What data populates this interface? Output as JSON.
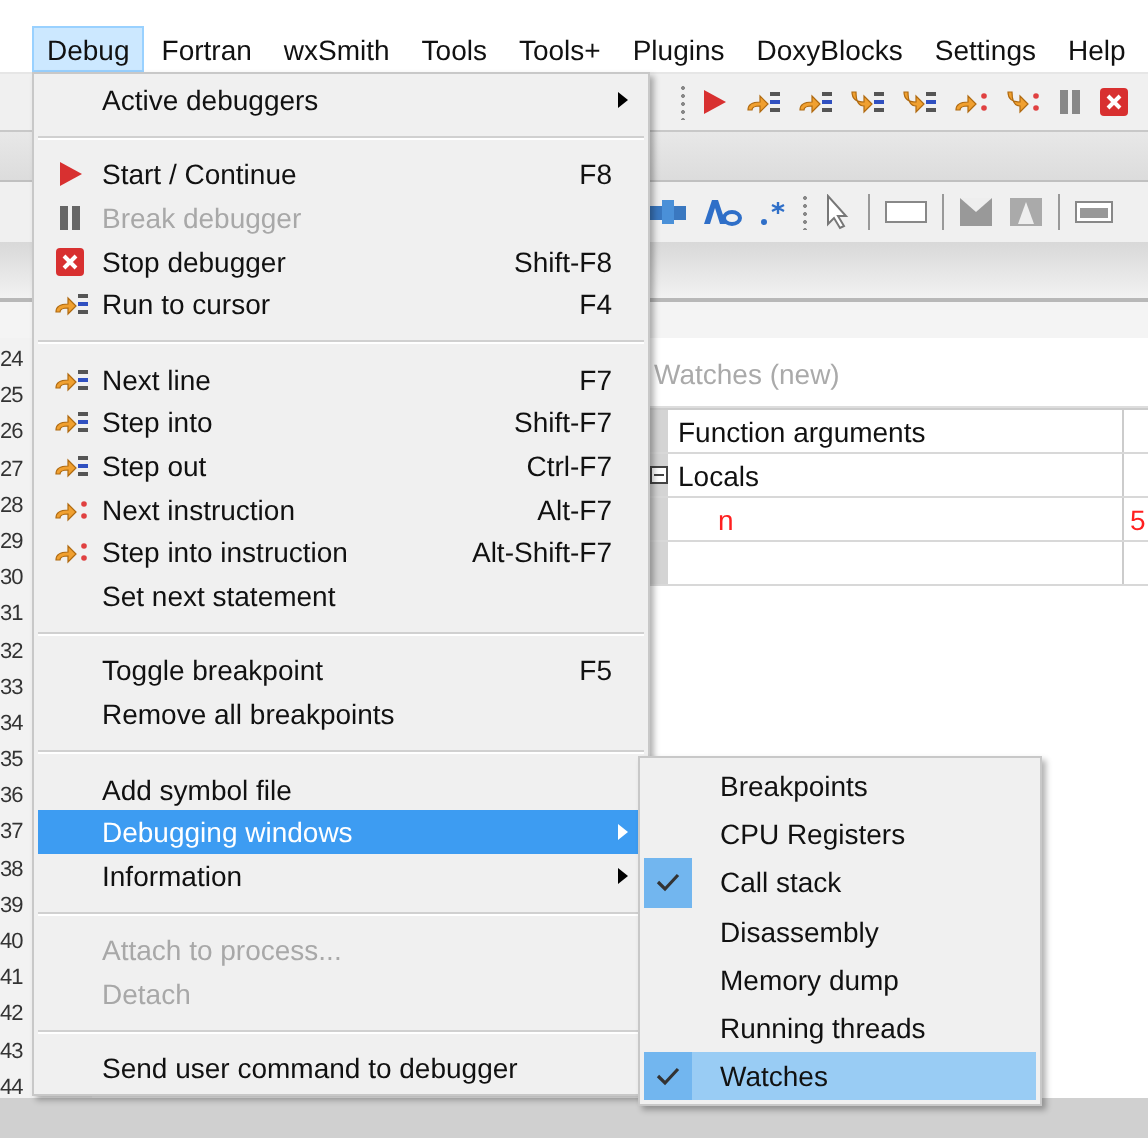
{
  "menubar": [
    {
      "label": "Debug",
      "selected": true
    },
    {
      "label": "Fortran",
      "selected": false
    },
    {
      "label": "wxSmith",
      "selected": false
    },
    {
      "label": "Tools",
      "selected": false
    },
    {
      "label": "Tools+",
      "selected": false
    },
    {
      "label": "Plugins",
      "selected": false
    },
    {
      "label": "DoxyBlocks",
      "selected": false
    },
    {
      "label": "Settings",
      "selected": false
    },
    {
      "label": "Help",
      "selected": false
    }
  ],
  "line_numbers": [
    "24",
    "25",
    "26",
    "27",
    "28",
    "29",
    "30",
    "31",
    "32",
    "33",
    "34",
    "35",
    "36",
    "37",
    "38",
    "39",
    "40",
    "41",
    "42",
    "43",
    "44"
  ],
  "watches": {
    "title": "Watches (new)",
    "rows": [
      {
        "kind": "group",
        "name": "Function arguments"
      },
      {
        "kind": "group",
        "name": "Locals",
        "expanded": true
      },
      {
        "kind": "variable",
        "name": "n",
        "value": "5",
        "changed": true
      }
    ]
  },
  "debug_menu": {
    "items": [
      {
        "kind": "item",
        "label": "Active debuggers",
        "submenu": true,
        "disabled": false,
        "selected": false
      },
      {
        "kind": "separator"
      },
      {
        "kind": "item",
        "label": "Start / Continue",
        "shortcut": "F8",
        "disabled": false,
        "selected": false
      },
      {
        "kind": "item",
        "label": "Break debugger",
        "disabled": true,
        "selected": false
      },
      {
        "kind": "item",
        "label": "Stop debugger",
        "shortcut": "Shift-F8",
        "disabled": false,
        "selected": false
      },
      {
        "kind": "item",
        "label": "Run to cursor",
        "shortcut": "F4",
        "disabled": false,
        "selected": false
      },
      {
        "kind": "separator"
      },
      {
        "kind": "item",
        "label": "Next line",
        "shortcut": "F7",
        "disabled": false,
        "selected": false
      },
      {
        "kind": "item",
        "label": "Step into",
        "shortcut": "Shift-F7",
        "disabled": false,
        "selected": false
      },
      {
        "kind": "item",
        "label": "Step out",
        "shortcut": "Ctrl-F7",
        "disabled": false,
        "selected": false
      },
      {
        "kind": "item",
        "label": "Next instruction",
        "shortcut": "Alt-F7",
        "disabled": false,
        "selected": false
      },
      {
        "kind": "item",
        "label": "Step into instruction",
        "shortcut": "Alt-Shift-F7",
        "disabled": false,
        "selected": false
      },
      {
        "kind": "item",
        "label": "Set next statement",
        "disabled": false,
        "selected": false
      },
      {
        "kind": "separator"
      },
      {
        "kind": "item",
        "label": "Toggle breakpoint",
        "shortcut": "F5",
        "disabled": false,
        "selected": false
      },
      {
        "kind": "item",
        "label": "Remove all breakpoints",
        "disabled": false,
        "selected": false
      },
      {
        "kind": "separator"
      },
      {
        "kind": "item",
        "label": "Add symbol file",
        "disabled": false,
        "selected": false
      },
      {
        "kind": "item",
        "label": "Debugging windows",
        "submenu": true,
        "disabled": false,
        "selected": true
      },
      {
        "kind": "item",
        "label": "Information",
        "submenu": true,
        "disabled": false,
        "selected": false
      },
      {
        "kind": "separator"
      },
      {
        "kind": "item",
        "label": "Attach to process...",
        "disabled": true,
        "selected": false
      },
      {
        "kind": "item",
        "label": "Detach",
        "disabled": true,
        "selected": false
      },
      {
        "kind": "separator"
      },
      {
        "kind": "item",
        "label": "Send user command to debugger",
        "disabled": false,
        "selected": false
      }
    ]
  },
  "debugging_windows_menu": {
    "items": [
      {
        "label": "Breakpoints",
        "checked": false,
        "selected": false
      },
      {
        "label": "CPU Registers",
        "checked": false,
        "selected": false
      },
      {
        "label": "Call stack",
        "checked": true,
        "selected": false
      },
      {
        "label": "Disassembly",
        "checked": false,
        "selected": false
      },
      {
        "label": "Memory dump",
        "checked": false,
        "selected": false
      },
      {
        "label": "Running threads",
        "checked": false,
        "selected": false
      },
      {
        "label": "Watches",
        "checked": true,
        "selected": true
      }
    ]
  }
}
